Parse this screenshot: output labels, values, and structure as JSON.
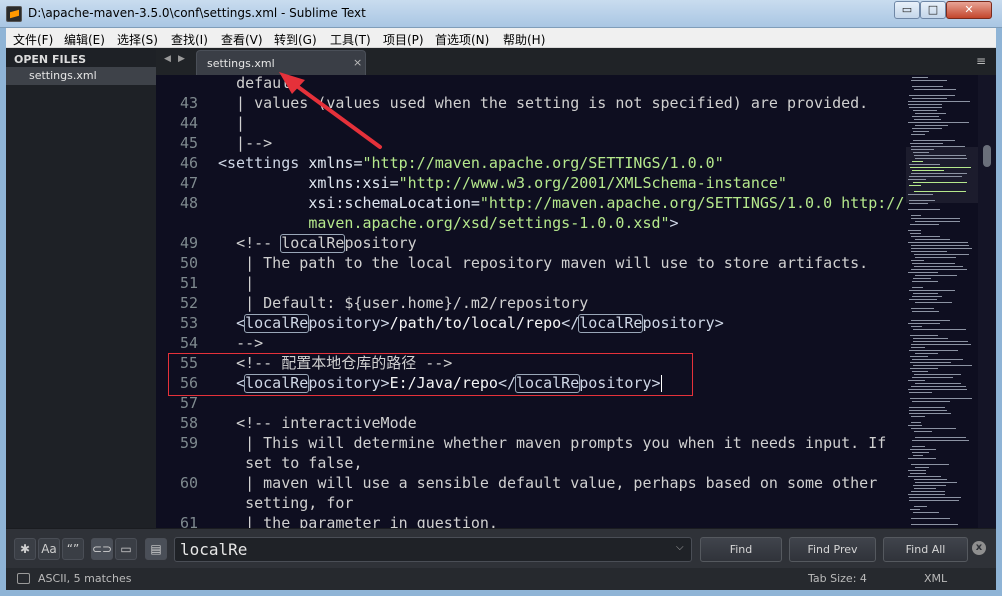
{
  "window": {
    "title": "D:\\apache-maven-3.5.0\\conf\\settings.xml - Sublime Text",
    "min_glyph": "▭",
    "max_glyph": "□",
    "close_glyph": "✕"
  },
  "menu": [
    "文件(F)",
    "编辑(E)",
    "选择(S)",
    "查找(I)",
    "查看(V)",
    "转到(G)",
    "工具(T)",
    "项目(P)",
    "首选项(N)",
    "帮助(H)"
  ],
  "sidebar": {
    "heading": "OPEN FILES",
    "files": [
      "settings.xml"
    ]
  },
  "tab": {
    "label": "settings.xml",
    "close": "×",
    "nav_left": "◀",
    "nav_right": "▶",
    "menu": "≡"
  },
  "code": {
    "gutter": [
      "",
      "43",
      "44",
      "45",
      "46",
      "47",
      "48",
      "",
      "49",
      "50",
      "51",
      "52",
      "53",
      "54",
      "55",
      "56",
      "57",
      "58",
      "59",
      "",
      "60",
      "",
      "61"
    ],
    "l0": "default",
    "l1": " | values (values used when the setting is not specified) are provided.",
    "l2": " |",
    "l3": " |-->",
    "l4a": "<settings ",
    "l4b": "xmlns=",
    "l4c": "\"http://maven.apache.org/SETTINGS/1.0.0\"",
    "l5b": "xmlns:xsi=",
    "l5c": "\"http://www.w3.org/2001/XMLSchema-instance\"",
    "l6b": "xsi:schemaLocation=",
    "l6c": "\"http://maven.apache.org/SETTINGS/1.0.0 http://",
    "l7c": "maven.apache.org/xsd/settings-1.0.0.xsd\"",
    "l7d": ">",
    "l8a": "<!-- ",
    "l8m": "localRe",
    "l8b": "pository",
    "l9": "| The path to the local repository maven will use to store artifacts.",
    "l10": "|",
    "l11": "| Default: ${user.home}/.m2/repository",
    "l12a": "<",
    "l12m": "localRe",
    "l12b": "pository>",
    "l12c": "/path/to/local/repo",
    "l12d": "</",
    "l12m2": "localRe",
    "l12e": "pository>",
    "l13": "-->",
    "l14": "<!-- 配置本地仓库的路径 -->",
    "l15a": "<",
    "l15m": "localRe",
    "l15b": "pository>",
    "l15c": "E:/Java/repo",
    "l15d": "</",
    "l15m2": "localRe",
    "l15e": "pository>",
    "l16": "",
    "l17": "<!-- interactiveMode",
    "l18": "| This will determine whether maven prompts you when it needs input. If",
    "l19": "set to false,",
    "l20": "| maven will use a sensible default value, perhaps based on some other",
    "l21": "setting, for",
    "l22": "| the parameter in question."
  },
  "find": {
    "query": "localRe",
    "dropdown": "⌵",
    "toggles": [
      "✱",
      "Aa",
      "“”",
      "⊂⊃",
      "▭",
      "▤"
    ],
    "find_label": "Find",
    "find_prev_label": "Find Prev",
    "find_all_label": "Find All",
    "close": "x"
  },
  "status": {
    "left": "ASCII, 5 matches",
    "tab_size": "Tab Size: 4",
    "syntax": "XML"
  },
  "colors": {
    "annotation": "#e5313a",
    "editor_bg": "#0e0e20",
    "string": "#b5e88c"
  }
}
